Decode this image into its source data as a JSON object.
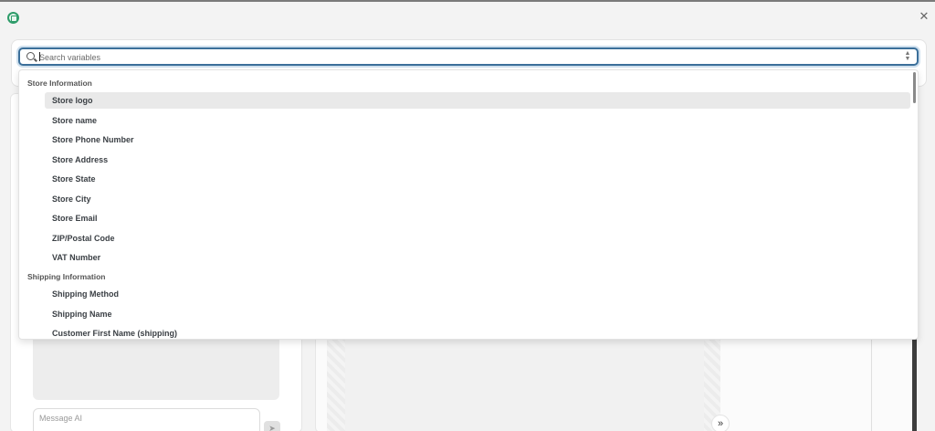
{
  "search": {
    "placeholder": "Search variables"
  },
  "dropdown": {
    "groups": [
      {
        "heading": "Store Information",
        "items": [
          "Store logo",
          "Store name",
          "Store Phone Number",
          "Store Address",
          "Store State",
          "Store City",
          "Store Email",
          "ZIP/Postal Code",
          "VAT Number"
        ]
      },
      {
        "heading": "Shipping Information",
        "items": [
          "Shipping Method",
          "Shipping Name",
          "Customer First Name (shipping)"
        ]
      }
    ],
    "highlighted_item": "Store logo"
  },
  "chat": {
    "message_placeholder": "Message AI"
  },
  "icons": {
    "expand": "double-chevron-right-icon",
    "close": "close-icon",
    "search": "search-icon",
    "sort": "up-down-chevron-icon"
  },
  "colors": {
    "focus_border": "#3b6f9a",
    "brand": "#2e9c6a"
  }
}
